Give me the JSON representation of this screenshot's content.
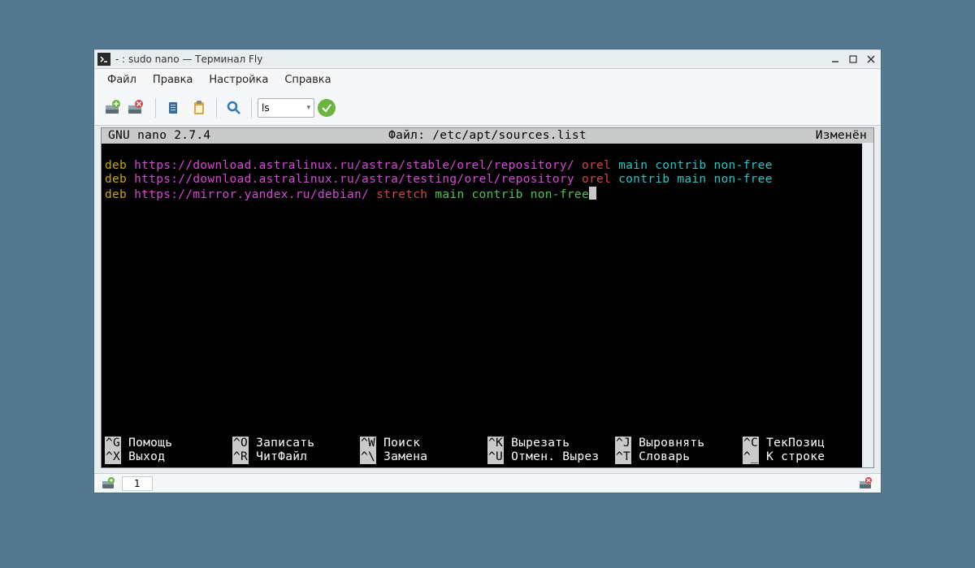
{
  "titlebar": {
    "title": "- : sudo nano — Терминал Fly"
  },
  "menubar": {
    "items": [
      "Файл",
      "Правка",
      "Настройка",
      "Справка"
    ]
  },
  "toolbar": {
    "combo_value": "ls"
  },
  "nano": {
    "header_left": "  GNU nano 2.7.4",
    "header_mid": "Файл: /etc/apt/sources.list",
    "header_right": "Изменён  "
  },
  "content": {
    "line1": {
      "p1": "deb ",
      "p2": "https://download.astralinux.ru/astra/stable/orel/repository/ ",
      "p3": "orel ",
      "p4": "main contrib non-free"
    },
    "line2": {
      "p1": "deb ",
      "p2": "https://download.astralinux.ru/astra/testing/orel/repository ",
      "p3": "orel ",
      "p4": "contrib main non-free"
    },
    "line3": {
      "p1": "deb ",
      "p2": "https://mirror.yandex.ru/debian/ ",
      "p3": "stretch ",
      "p4": "main contrib non-free"
    }
  },
  "shortcuts": [
    {
      "key": "^G",
      "label": " Помощь"
    },
    {
      "key": "^O",
      "label": " Записать"
    },
    {
      "key": "^W",
      "label": " Поиск"
    },
    {
      "key": "^K",
      "label": " Вырезать"
    },
    {
      "key": "^J",
      "label": " Выровнять"
    },
    {
      "key": "^C",
      "label": " ТекПозиц"
    },
    {
      "key": "^X",
      "label": " Выход"
    },
    {
      "key": "^R",
      "label": " ЧитФайл"
    },
    {
      "key": "^\\",
      "label": " Замена"
    },
    {
      "key": "^U",
      "label": " Отмен. Вырез"
    },
    {
      "key": "^T",
      "label": " Словарь"
    },
    {
      "key": "^_",
      "label": " К строке"
    }
  ],
  "status": {
    "tab": "1"
  }
}
